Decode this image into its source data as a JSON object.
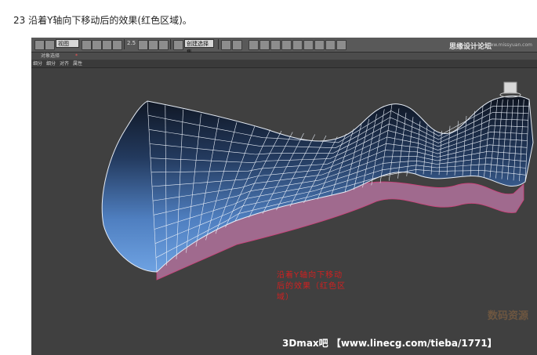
{
  "caption": "23 沿着Y轴向下移动后的效果(红色区域)。",
  "toolbar": {
    "view_dropdown": "视图",
    "count_label": "2.5",
    "selection_set": "创建选择集",
    "forum_title": "思缘设计论坛",
    "forum_url": "www.missyuan.com"
  },
  "subbar": {
    "label": "对象选择",
    "marker": "*"
  },
  "menu": {
    "items": [
      "细分",
      "细分",
      "对齐",
      "属性"
    ]
  },
  "viewport": {
    "annotation": "沿着Y轴向下移动后的效果（红色区域）",
    "watermark": "3Dmax吧 【www.linecg.com/tieba/1771】",
    "logo_text": "数码资源",
    "colors": {
      "background": "#404040",
      "surface_top": "#0e1420",
      "surface_bottom": "#6ea2e2",
      "extrusion": "#a06a8e",
      "annotation": "#d22020"
    }
  }
}
